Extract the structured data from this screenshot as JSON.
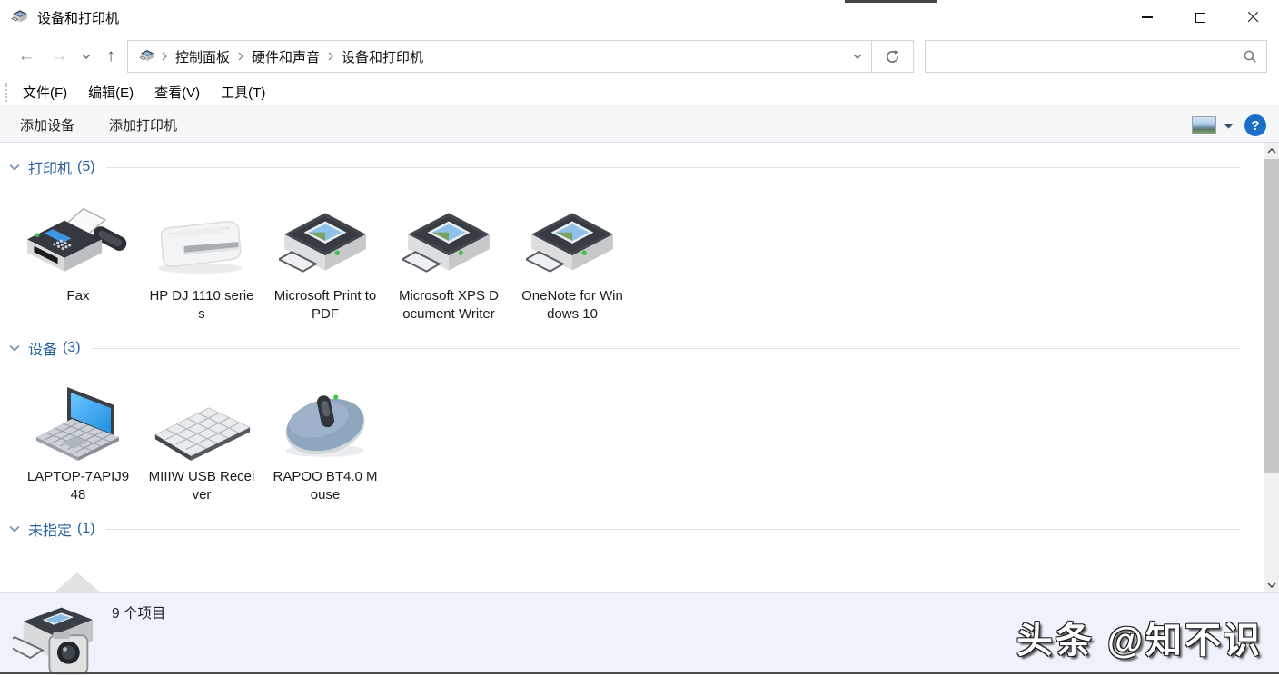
{
  "window": {
    "title": "设备和打印机"
  },
  "navbar": {
    "breadcrumb": {
      "crumbs": [
        "控制面板",
        "硬件和声音",
        "设备和打印机"
      ]
    },
    "search": {
      "value": "",
      "placeholder": ""
    }
  },
  "menubar": {
    "items": [
      "文件(F)",
      "编辑(E)",
      "查看(V)",
      "工具(T)"
    ]
  },
  "toolbar": {
    "items": [
      "添加设备",
      "添加打印机"
    ],
    "help_label": "?"
  },
  "sections": [
    {
      "title": "打印机",
      "count": "(5)",
      "items": [
        {
          "name": "Fax",
          "icon": "fax-icon"
        },
        {
          "name": "HP DJ 1110 series",
          "icon": "hp-printer-icon"
        },
        {
          "name": "Microsoft Print to PDF",
          "icon": "printer-icon"
        },
        {
          "name": "Microsoft XPS Document Writer",
          "icon": "printer-icon"
        },
        {
          "name": "OneNote for Windows 10",
          "icon": "printer-icon"
        }
      ]
    },
    {
      "title": "设备",
      "count": "(3)",
      "items": [
        {
          "name": "LAPTOP-7APIJ948",
          "icon": "laptop-icon"
        },
        {
          "name": "MIIIW USB Receiver",
          "icon": "keyboard-icon"
        },
        {
          "name": "RAPOO BT4.0 Mouse",
          "icon": "mouse-icon"
        }
      ]
    },
    {
      "title": "未指定",
      "count": "(1)",
      "items": []
    }
  ],
  "statusbar": {
    "count_text": "9 个项目"
  },
  "watermark": {
    "text": "头条 @知不识"
  },
  "colors": {
    "section_header_blue": "#26609f",
    "help_button_blue": "#1b6fc9",
    "statusbar_bg": "#eef3fb",
    "toolbar_bg": "#f6f7f9",
    "screen_blue": "#2e9df0",
    "led_green": "#3fc143"
  }
}
